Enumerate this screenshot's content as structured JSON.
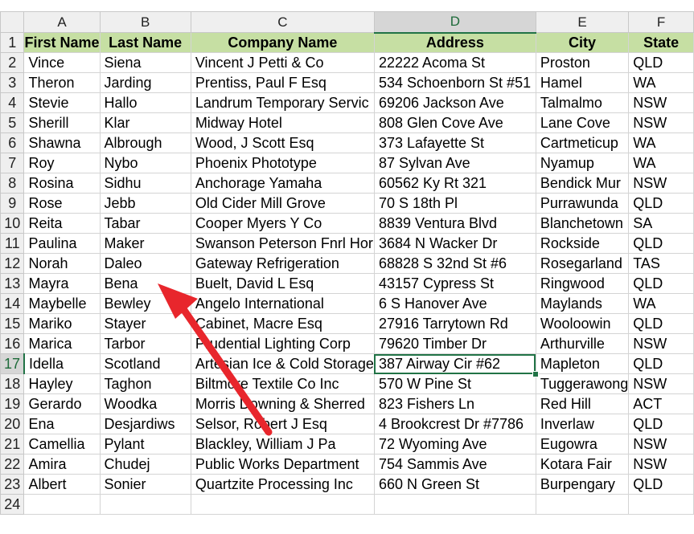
{
  "columns": [
    "A",
    "B",
    "C",
    "D",
    "E",
    "F"
  ],
  "selected_column": "D",
  "selected_row": "17",
  "header_row": {
    "row_number": "1",
    "labels": [
      "First Name",
      "Last Name",
      "Company Name",
      "Address",
      "City",
      "State"
    ]
  },
  "rows": [
    {
      "n": "2",
      "cells": [
        "Vince",
        "Siena",
        "Vincent J Petti & Co",
        "22222 Acoma St",
        "Proston",
        "QLD"
      ]
    },
    {
      "n": "3",
      "cells": [
        "Theron",
        "Jarding",
        "Prentiss, Paul F Esq",
        "534 Schoenborn St #51",
        "Hamel",
        "WA"
      ]
    },
    {
      "n": "4",
      "cells": [
        "Stevie",
        "Hallo",
        "Landrum Temporary Servic",
        "69206 Jackson Ave",
        "Talmalmo",
        "NSW"
      ]
    },
    {
      "n": "5",
      "cells": [
        "Sherill",
        "Klar",
        "Midway Hotel",
        "808 Glen Cove Ave",
        "Lane Cove",
        "NSW"
      ]
    },
    {
      "n": "6",
      "cells": [
        "Shawna",
        "Albrough",
        "Wood, J Scott Esq",
        "373 Lafayette St",
        "Cartmeticup",
        "WA"
      ]
    },
    {
      "n": "7",
      "cells": [
        "Roy",
        "Nybo",
        "Phoenix Phototype",
        "87 Sylvan Ave",
        "Nyamup",
        "WA"
      ]
    },
    {
      "n": "8",
      "cells": [
        "Rosina",
        "Sidhu",
        "Anchorage Yamaha",
        "60562 Ky Rt 321",
        "Bendick Mur",
        "NSW"
      ]
    },
    {
      "n": "9",
      "cells": [
        "Rose",
        "Jebb",
        "Old Cider Mill Grove",
        "70 S 18th Pl",
        "Purrawunda",
        "QLD"
      ]
    },
    {
      "n": "10",
      "cells": [
        "Reita",
        "Tabar",
        "Cooper Myers Y Co",
        "8839 Ventura Blvd",
        "Blanchetown",
        "SA"
      ]
    },
    {
      "n": "11",
      "cells": [
        "Paulina",
        "Maker",
        "Swanson Peterson Fnrl Hor",
        "3684 N Wacker Dr",
        "Rockside",
        "QLD"
      ]
    },
    {
      "n": "12",
      "cells": [
        "Norah",
        "Daleo",
        "Gateway Refrigeration",
        "68828 S 32nd St #6",
        "Rosegarland",
        "TAS"
      ]
    },
    {
      "n": "13",
      "cells": [
        "Mayra",
        "Bena",
        "Buelt, David L Esq",
        "43157 Cypress St",
        "Ringwood",
        "QLD"
      ]
    },
    {
      "n": "14",
      "cells": [
        "Maybelle",
        "Bewley",
        "Angelo International",
        "6 S Hanover Ave",
        "Maylands",
        "WA"
      ]
    },
    {
      "n": "15",
      "cells": [
        "Mariko",
        "Stayer",
        "Cabinet, Macre Esq",
        "27916 Tarrytown Rd",
        "Wooloowin",
        "QLD"
      ]
    },
    {
      "n": "16",
      "cells": [
        "Marica",
        "Tarbor",
        "Prudential Lighting Corp",
        "79620 Timber Dr",
        "Arthurville",
        "NSW"
      ]
    },
    {
      "n": "17",
      "cells": [
        "Idella",
        "Scotland",
        "Artesian Ice & Cold Storage",
        "387 Airway Cir #62",
        "Mapleton",
        "QLD"
      ]
    },
    {
      "n": "18",
      "cells": [
        "Hayley",
        "Taghon",
        "Biltmore Textile Co Inc",
        "570 W Pine St",
        "Tuggerawong",
        "NSW"
      ]
    },
    {
      "n": "19",
      "cells": [
        "Gerardo",
        "Woodka",
        "Morris Downing & Sherred",
        "823 Fishers Ln",
        "Red Hill",
        "ACT"
      ]
    },
    {
      "n": "20",
      "cells": [
        "Ena",
        "Desjardiws",
        "Selsor, Robert J Esq",
        "4 Brookcrest Dr #7786",
        "Inverlaw",
        "QLD"
      ]
    },
    {
      "n": "21",
      "cells": [
        "Camellia",
        "Pylant",
        "Blackley, William J Pa",
        "72 Wyoming Ave",
        "Eugowra",
        "NSW"
      ]
    },
    {
      "n": "22",
      "cells": [
        "Amira",
        "Chudej",
        "Public Works Department",
        "754 Sammis Ave",
        "Kotara Fair",
        "NSW"
      ]
    },
    {
      "n": "23",
      "cells": [
        "Albert",
        "Sonier",
        "Quartzite Processing Inc",
        "660 N Green St",
        "Burpengary",
        "QLD"
      ]
    }
  ],
  "empty_row": "24",
  "colors": {
    "header_fill": "#c6dfa3",
    "selection": "#217346",
    "arrow": "#e8262c"
  }
}
